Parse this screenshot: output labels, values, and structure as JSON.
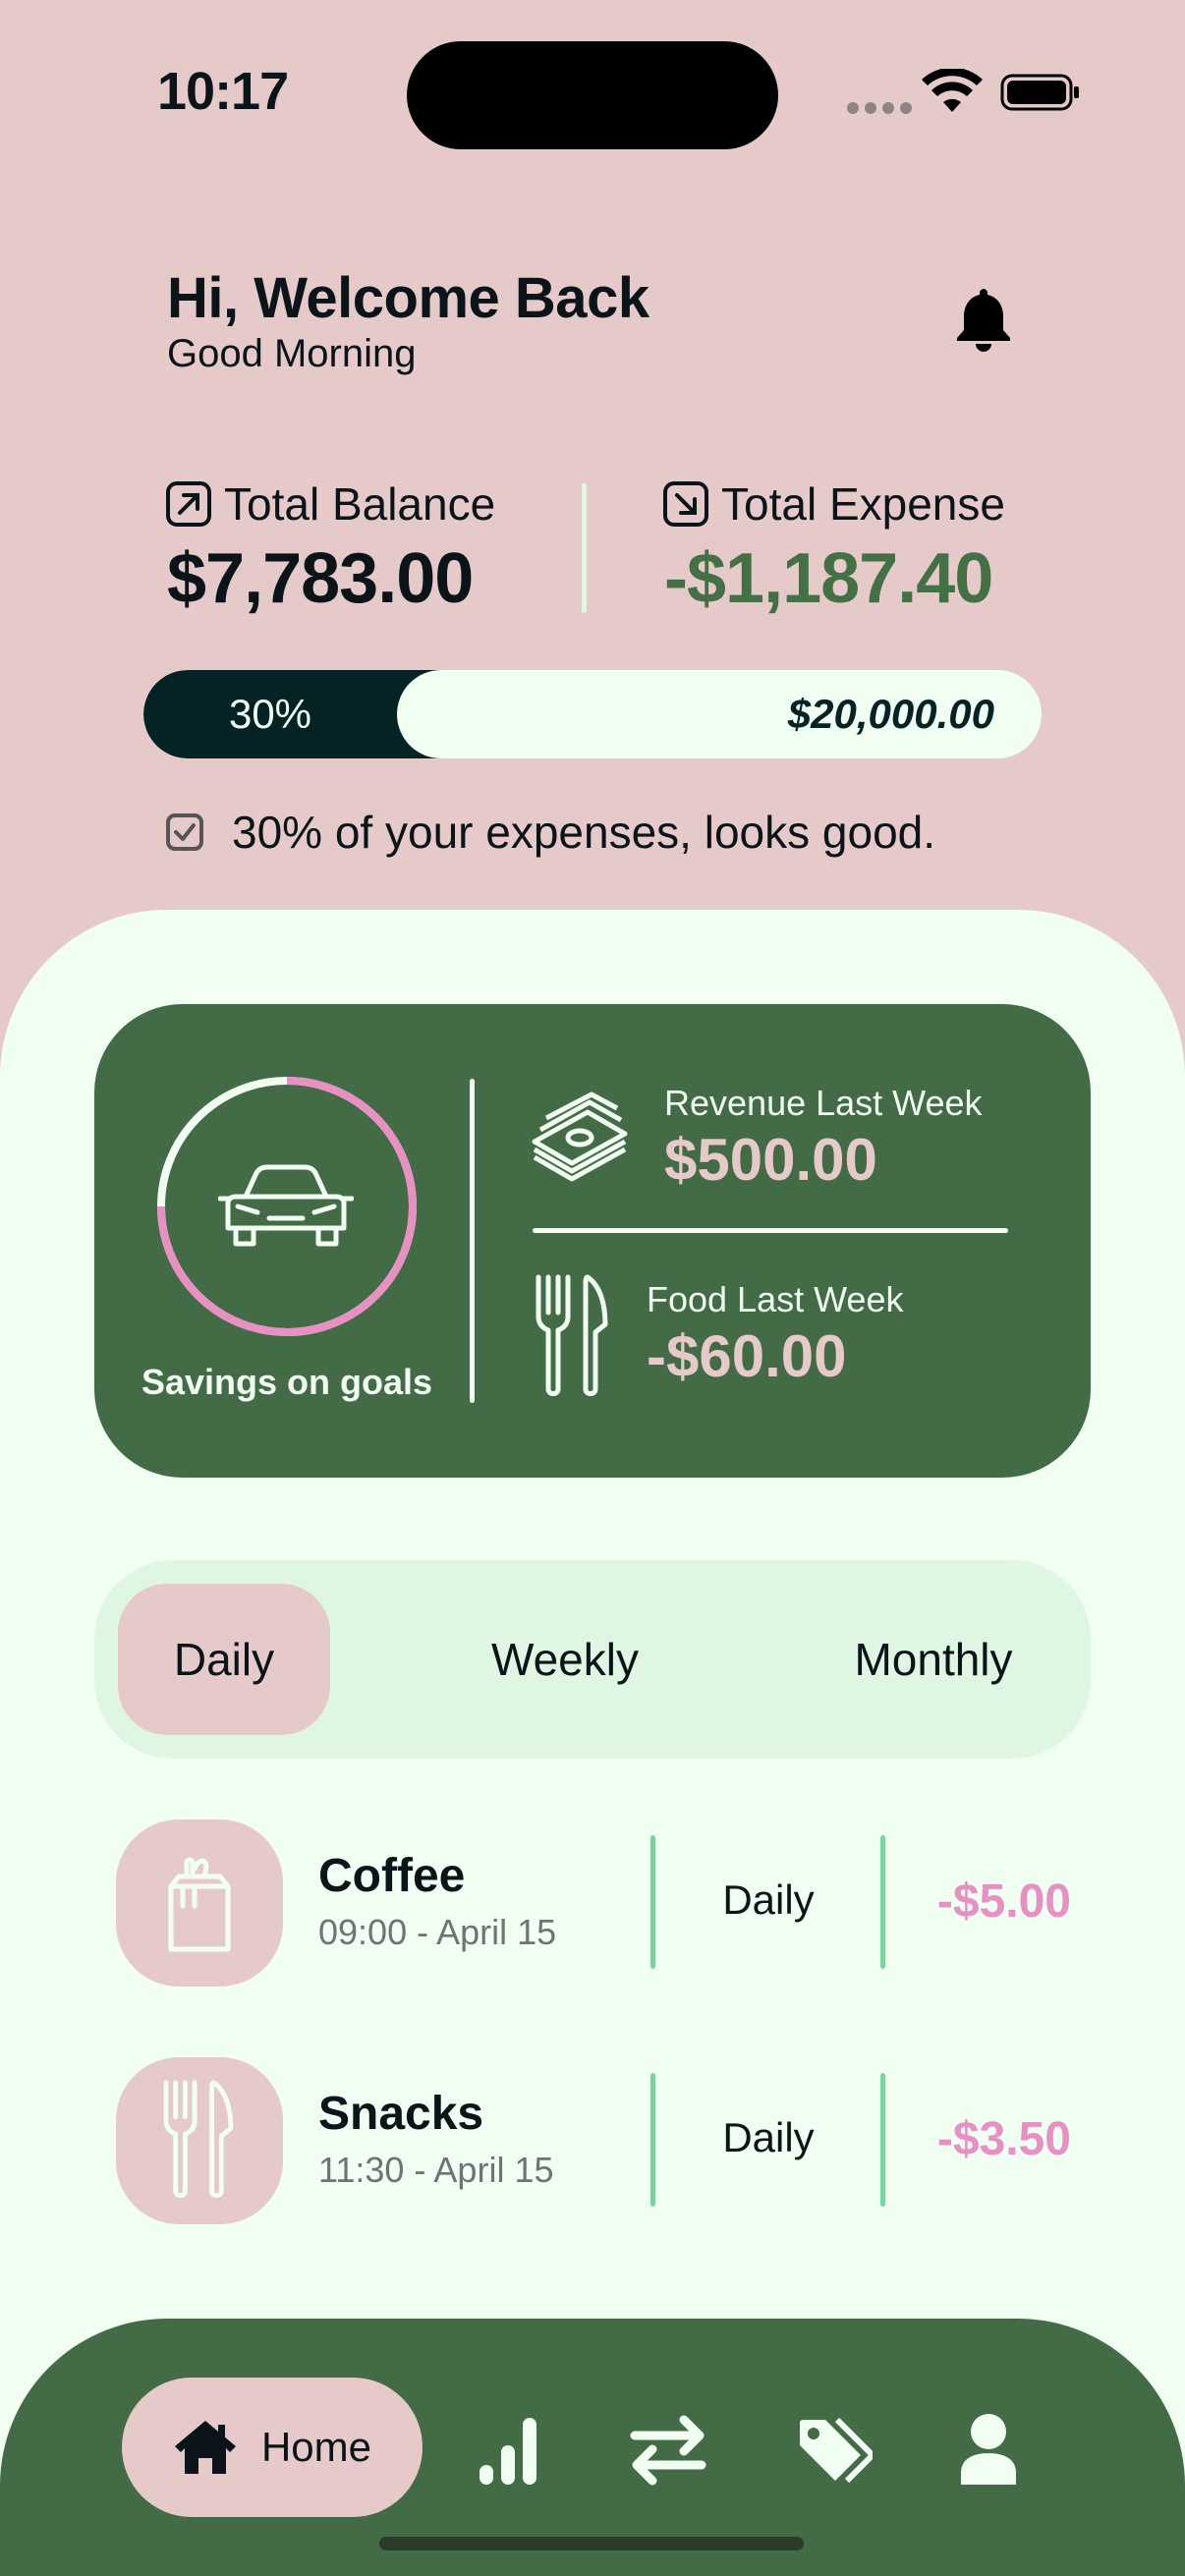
{
  "status_bar": {
    "time": "10:17"
  },
  "header": {
    "title": "Hi, Welcome Back",
    "subtitle": "Good Morning"
  },
  "balance": {
    "total_balance_label": "Total Balance",
    "total_balance_value": "$7,783.00",
    "total_expense_label": "Total Expense",
    "total_expense_value": "-$1,187.40"
  },
  "progress": {
    "percent_label": "30%",
    "percent_value": 0.3,
    "goal": "$20,000.00",
    "message": "30% of your expenses, looks good."
  },
  "goal_card": {
    "savings_label": "Savings on goals",
    "revenue_label": "Revenue Last Week",
    "revenue_value": "$500.00",
    "food_label": "Food Last Week",
    "food_value": "-$60.00"
  },
  "tabs": [
    {
      "label": "Daily",
      "active": true
    },
    {
      "label": "Weekly",
      "active": false
    },
    {
      "label": "Monthly",
      "active": false
    }
  ],
  "transactions": [
    {
      "title": "Coffee",
      "time": "09:00 - April 15",
      "frequency": "Daily",
      "amount": "-$5.00",
      "icon": "grocery-bag-icon"
    },
    {
      "title": "Snacks",
      "time": "11:30 - April 15",
      "frequency": "Daily",
      "amount": "-$3.50",
      "icon": "fork-knife-icon"
    }
  ],
  "nav": {
    "home_label": "Home",
    "items": [
      "home-icon",
      "analysis-icon",
      "transfer-icon",
      "category-tag-icon",
      "profile-icon"
    ]
  },
  "colors": {
    "background": "#E6CACA",
    "sheet": "#F1FFF3",
    "card": "#436B46",
    "dark": "#052224",
    "expense_green": "#437045",
    "amount_pink": "#E890C3",
    "divider_mint": "#7BD3A0"
  }
}
